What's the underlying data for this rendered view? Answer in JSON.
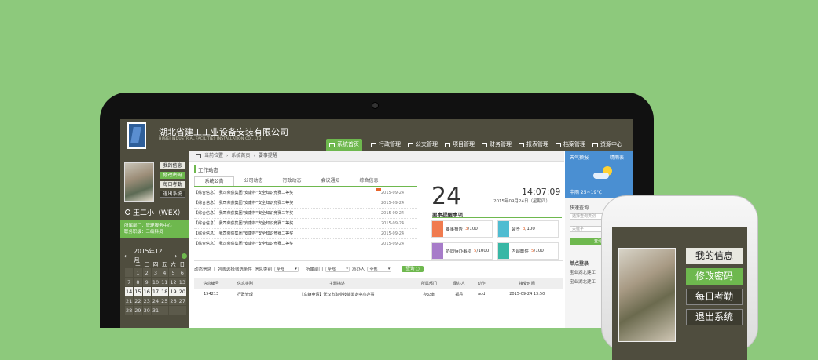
{
  "header": {
    "company_cn": "湖北省建工工业设备安装有限公司",
    "company_en": "HUBEI INDUSTRIAL FACILITIES INSTALLATION CO., LTD.",
    "nav": [
      "系统首页",
      "行政管理",
      "公文管理",
      "项目管理",
      "财务管理",
      "报表管理",
      "档案管理",
      "资源中心"
    ]
  },
  "sidebar": {
    "buttons": [
      "我的信息",
      "修改密码",
      "每日考勤",
      "退出系统"
    ],
    "user": "王二小（WEX）",
    "dept": "所属部门：管理服务中心",
    "role": "职务职级：三级科员",
    "cal_month": "2015年12月",
    "weekdays": [
      "一",
      "二",
      "三",
      "四",
      "五",
      "六",
      "日"
    ],
    "cal_rows": [
      [
        "",
        "1",
        "2",
        "3",
        "4",
        "5",
        "6"
      ],
      [
        "7",
        "8",
        "9",
        "10",
        "11",
        "12",
        "13"
      ],
      [
        "14",
        "15",
        "16",
        "17",
        "18",
        "19",
        "20"
      ],
      [
        "21",
        "22",
        "23",
        "24",
        "25",
        "26",
        "27"
      ],
      [
        "28",
        "29",
        "30",
        "31",
        "",
        "",
        ""
      ]
    ]
  },
  "main": {
    "breadcrumb": [
      "当前位置",
      "系统首页",
      "要事提醒"
    ],
    "section": "工作动态",
    "tabs": [
      "系统公告",
      "公司动态",
      "行政动态",
      "会议通知",
      "综合信息"
    ],
    "news": [
      {
        "t": "【综合信息】 我司荣获集团\"安康杯\"安全知识竞赛二等奖",
        "d": "2015-09-24",
        "new": true
      },
      {
        "t": "【综合信息】 我司荣获集团\"安康杯\"安全知识竞赛二等奖",
        "d": "2015-09-24",
        "new": false
      },
      {
        "t": "【综合信息】 我司荣获集团\"安康杯\"安全知识竞赛二等奖",
        "d": "2015-09-24",
        "new": false
      },
      {
        "t": "【综合信息】 我司荣获集团\"安康杯\"安全知识竞赛二等奖",
        "d": "2015-09-24",
        "new": false
      },
      {
        "t": "【综合信息】 我司荣获集团\"安康杯\"安全知识竞赛二等奖",
        "d": "2015-09-24",
        "new": false
      },
      {
        "t": "【综合信息】 我司荣获集团\"安康杯\"安全知识竞赛二等奖",
        "d": "2015-09-24",
        "new": false
      }
    ],
    "day": "24",
    "time": "14:07:09",
    "date_line": "2015年09月24日（星期四）",
    "reminders_title": "要事提醒事项",
    "reminders": [
      {
        "label": "要事报告",
        "value": "3",
        "total": "/100",
        "color": "#f07b4f"
      },
      {
        "label": "会签",
        "value": "3",
        "total": "/100",
        "color": "#4fbcd1"
      },
      {
        "label": "协同待办事项",
        "value": "5",
        "total": "/1000",
        "color": "#a77cc9"
      },
      {
        "label": "内部邮件",
        "value": "5",
        "total": "/100",
        "color": "#38b7a5"
      }
    ],
    "filter": {
      "label1": "动态信息",
      "label2": "列表选择筛选条件",
      "f1": "信息类别",
      "f2": "所属部门",
      "f3": "承办人",
      "opt": "全部",
      "btn": "查询"
    },
    "table": {
      "headers": [
        "信息编号",
        "信息类别",
        "主题描述",
        "所属部门",
        "承办人",
        "动作",
        "接受时间"
      ],
      "rows": [
        [
          "154213",
          "行政管理",
          "【车辆申请】武汉市职业技能鉴定中心办事",
          "办公室",
          "郑丹",
          "add",
          "2015-09-24 13:50"
        ]
      ]
    }
  },
  "right": {
    "weather_title": "天气预报",
    "weather_tab": "晴雨表",
    "weather_text": "中雨 25~19℃",
    "qs_title": "快速查询",
    "qs_ph1": "选择查询类别",
    "qs_ph2": "关键字",
    "qs_btn": "查询",
    "login_title": "单点登录",
    "login_items": [
      "宝业湖北建工",
      "宝业湖北建工"
    ]
  },
  "phone": {
    "buttons": [
      "我的信息",
      "修改密码",
      "每日考勤",
      "退出系统"
    ]
  }
}
